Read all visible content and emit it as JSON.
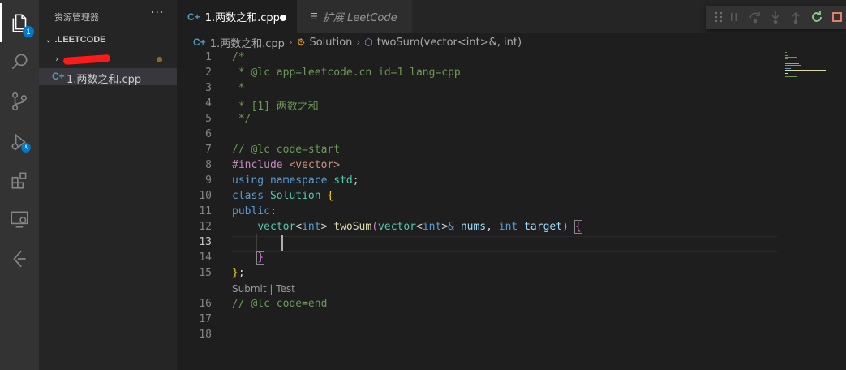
{
  "explorer": {
    "title": "资源管理器",
    "more": "···",
    "section": ".LEETCODE",
    "file": "1.两数之和.cpp",
    "badge": "1"
  },
  "tabs": [
    {
      "label": "1.两数之和.cpp",
      "icon": "cpp-icon"
    },
    {
      "label": "扩展 LeetCode",
      "icon": "extension-preview-icon"
    }
  ],
  "breadcrumb": {
    "file": "1.两数之和.cpp",
    "class": "Solution",
    "method": "twoSum(vector<int>&, int)"
  },
  "editor": {
    "line_numbers": [
      "1",
      "2",
      "3",
      "4",
      "5",
      "6",
      "7",
      "8",
      "9",
      "10",
      "11",
      "12",
      "13",
      "14",
      "15",
      "16",
      "17",
      "18"
    ],
    "codelens": "Submit | Test"
  },
  "colors": {
    "accent": "#007acc",
    "comment": "#6a9955",
    "keyword": "#569cd6",
    "type": "#4ec9b0",
    "function": "#dcdcaa"
  }
}
